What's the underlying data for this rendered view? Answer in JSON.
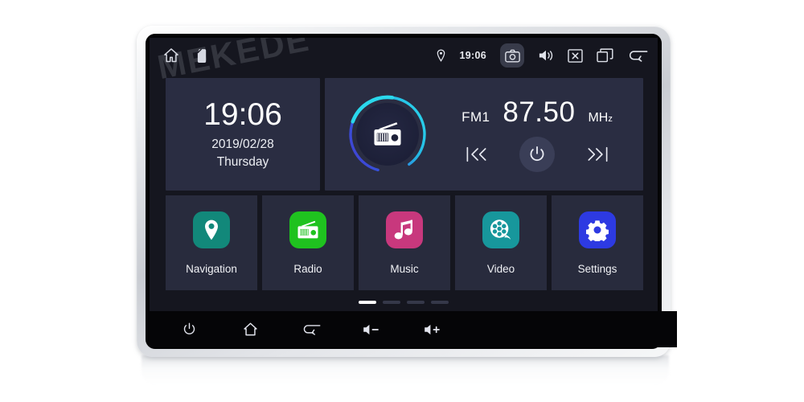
{
  "device": {
    "brand_watermark": "MEKEDE"
  },
  "statusbar": {
    "home_icon": "home-icon",
    "sdcard_icon": "sdcard-icon",
    "location_icon": "location-pin-icon",
    "time": "19:06",
    "camera_icon": "camera-icon",
    "volume_icon": "volume-icon",
    "close_icon": "close-box-icon",
    "recents_icon": "recents-icon",
    "back_icon": "back-arrow-icon"
  },
  "clock_widget": {
    "time": "19:06",
    "date": "2019/02/28",
    "weekday": "Thursday"
  },
  "radio_widget": {
    "icon": "radio-icon",
    "band": "FM1",
    "frequency": "87.50",
    "unit_main": "MH",
    "unit_sub": "z",
    "prev_label": "prev-station",
    "power_label": "radio-power",
    "next_label": "next-station",
    "ring_color_start": "#29d6ea",
    "ring_color_end": "#3f4ad6"
  },
  "apps": [
    {
      "label": "Navigation",
      "icon": "location-pin-icon",
      "color": "#12887a"
    },
    {
      "label": "Radio",
      "icon": "radio-icon",
      "color": "#1fc21f"
    },
    {
      "label": "Music",
      "icon": "music-note-icon",
      "color": "#c8387d"
    },
    {
      "label": "Video",
      "icon": "film-reel-icon",
      "color": "#17979c"
    },
    {
      "label": "Settings",
      "icon": "gear-icon",
      "color": "#2d3ae2"
    }
  ],
  "pager": {
    "pages": 4,
    "active_index": 0
  },
  "hardware_buttons": [
    {
      "name": "power-button",
      "icon": "power-icon"
    },
    {
      "name": "home-button",
      "icon": "home-icon"
    },
    {
      "name": "back-button",
      "icon": "back-arrow-icon"
    },
    {
      "name": "volume-down-button",
      "icon": "volume-down-icon"
    },
    {
      "name": "volume-up-button",
      "icon": "volume-up-icon"
    }
  ]
}
